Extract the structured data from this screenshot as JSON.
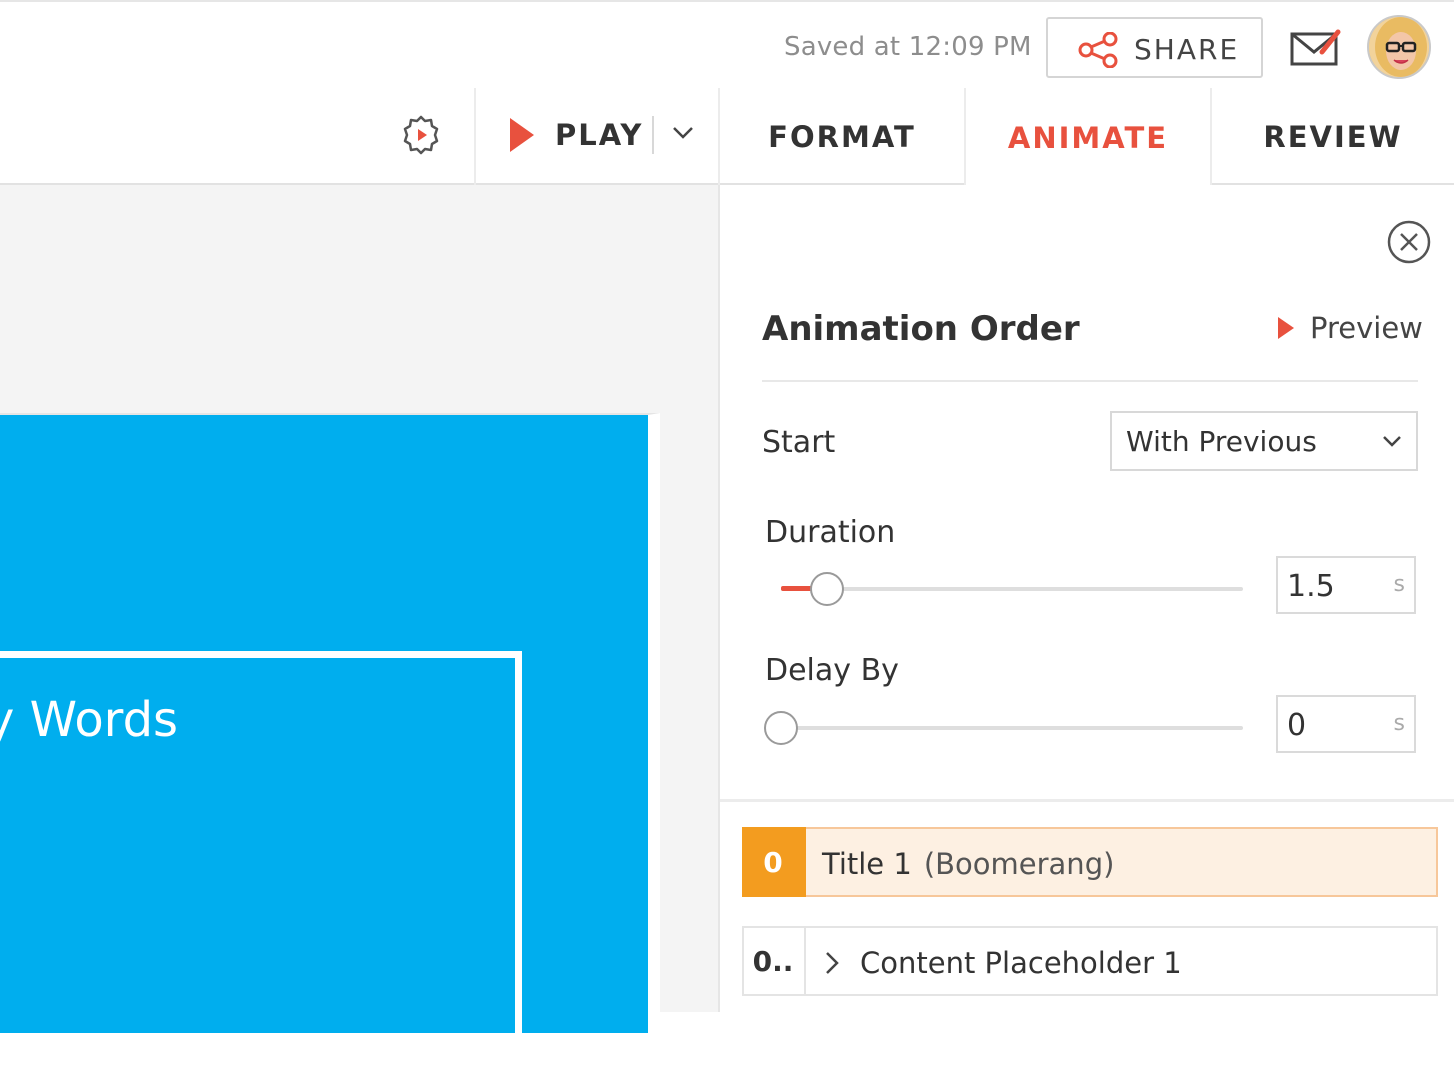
{
  "header": {
    "saved_status": "Saved at 12:09 PM",
    "share_label": "SHARE"
  },
  "tabs": {
    "play_label": "PLAY",
    "format_label": "FORMAT",
    "animate_label": "ANIMATE",
    "review_label": "REVIEW",
    "active_tab": "ANIMATE"
  },
  "slide": {
    "visible_text": "y Words",
    "background_color": "#00aeee"
  },
  "panel": {
    "title": "Animation Order",
    "preview_label": "Preview",
    "start": {
      "label": "Start",
      "value": "With Previous"
    },
    "duration": {
      "label": "Duration",
      "value": "1.5",
      "unit": "s",
      "slider_fraction": 0.1
    },
    "delay": {
      "label": "Delay By",
      "value": "0",
      "unit": "s",
      "slider_fraction": 0
    },
    "order_items": [
      {
        "number": "0",
        "name": "Title 1",
        "effect": "(Boomerang)",
        "active": true
      },
      {
        "number": "0..",
        "name": "Content Placeholder 1",
        "effect": "",
        "active": false
      }
    ]
  },
  "colors": {
    "accent": "#e8513e",
    "order_highlight": "#f39c1f",
    "slide_blue": "#00aeee"
  }
}
